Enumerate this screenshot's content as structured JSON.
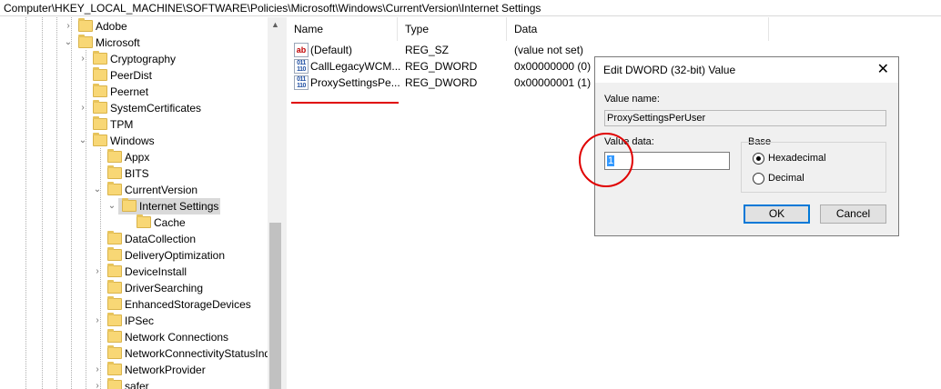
{
  "address_bar": {
    "path": "Computer\\HKEY_LOCAL_MACHINE\\SOFTWARE\\Policies\\Microsoft\\Windows\\CurrentVersion\\Internet Settings"
  },
  "tree": {
    "items": [
      {
        "label": "Adobe",
        "expander": "›"
      },
      {
        "label": "Microsoft",
        "expander": "⌄"
      },
      {
        "label": "Cryptography",
        "expander": "›"
      },
      {
        "label": "PeerDist",
        "expander": ""
      },
      {
        "label": "Peernet",
        "expander": ""
      },
      {
        "label": "SystemCertificates",
        "expander": "›"
      },
      {
        "label": "TPM",
        "expander": ""
      },
      {
        "label": "Windows",
        "expander": "⌄"
      },
      {
        "label": "Appx",
        "expander": ""
      },
      {
        "label": "BITS",
        "expander": ""
      },
      {
        "label": "CurrentVersion",
        "expander": "⌄"
      },
      {
        "label": "Internet Settings",
        "expander": "⌄"
      },
      {
        "label": "Cache",
        "expander": ""
      },
      {
        "label": "DataCollection",
        "expander": ""
      },
      {
        "label": "DeliveryOptimization",
        "expander": ""
      },
      {
        "label": "DeviceInstall",
        "expander": "›"
      },
      {
        "label": "DriverSearching",
        "expander": ""
      },
      {
        "label": "EnhancedStorageDevices",
        "expander": ""
      },
      {
        "label": "IPSec",
        "expander": "›"
      },
      {
        "label": "Network Connections",
        "expander": ""
      },
      {
        "label": "NetworkConnectivityStatusIndicator",
        "expander": ""
      },
      {
        "label": "NetworkProvider",
        "expander": "›"
      },
      {
        "label": "safer",
        "expander": "›"
      }
    ],
    "scroll_up": "▲",
    "scroll_down": "▼"
  },
  "list": {
    "columns": [
      "Name",
      "Type",
      "Data"
    ],
    "rows": [
      {
        "icon": "string-value-icon",
        "icon_text": "ab",
        "name": "(Default)",
        "type": "REG_SZ",
        "data": "(value not set)"
      },
      {
        "icon": "binary-value-icon",
        "icon_text": "011\n110",
        "name": "CallLegacyWCM...",
        "type": "REG_DWORD",
        "data": "0x00000000 (0)"
      },
      {
        "icon": "binary-value-icon",
        "icon_text": "011\n110",
        "name": "ProxySettingsPe...",
        "type": "REG_DWORD",
        "data": "0x00000001 (1)"
      }
    ]
  },
  "dialog": {
    "title": "Edit DWORD (32-bit) Value",
    "close_glyph": "✕",
    "value_name_label": "Value name:",
    "value_name": "ProxySettingsPerUser",
    "value_data_label": "Value data:",
    "value_data": "1",
    "base_label": "Base",
    "hex_label": "Hexadecimal",
    "dec_label": "Decimal",
    "base_selected": "Hexadecimal",
    "ok_label": "OK",
    "cancel_label": "Cancel"
  },
  "colors": {
    "annotation": "#e00000",
    "folder": "#f8d775",
    "selection": "#3399ff",
    "ok_border": "#0078d7"
  }
}
